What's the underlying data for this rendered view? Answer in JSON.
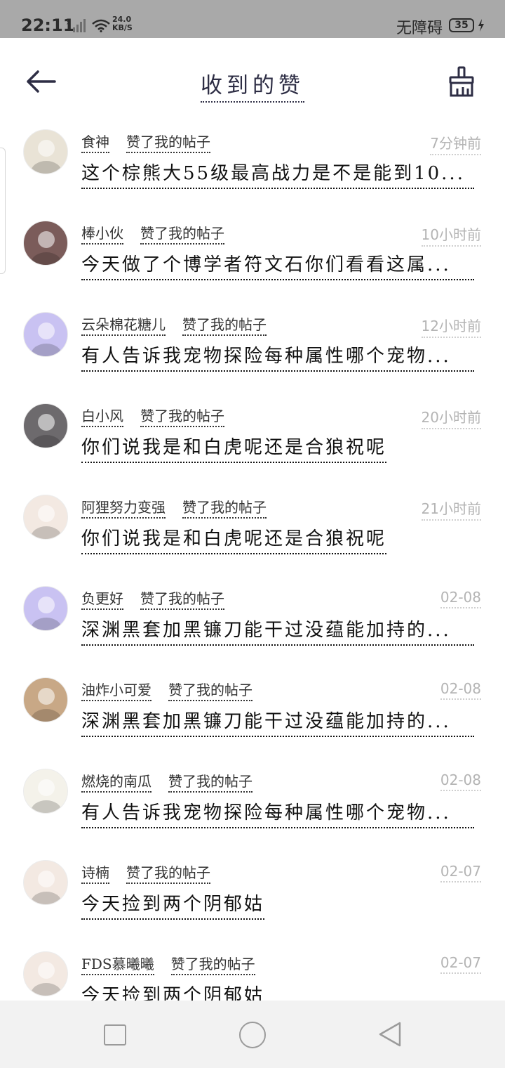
{
  "status_bar": {
    "time": "22:11",
    "speed_value": "24.0",
    "speed_unit": "KB/S",
    "accessibility": "无障碍",
    "battery": "35"
  },
  "header": {
    "title": "收到的赞",
    "back_icon": "arrow-left-icon",
    "clear_icon": "broom-icon"
  },
  "likes": [
    {
      "user": "食神",
      "action": "赞了我的帖子",
      "time": "7分钟前",
      "content": "这个棕熊大55级最高战力是不是能到10...",
      "avatar_color": "#e9e3d6"
    },
    {
      "user": "棒小伙",
      "action": "赞了我的帖子",
      "time": "10小时前",
      "content": "今天做了个博学者符文石你们看看这属...",
      "avatar_color": "#7b5c5a"
    },
    {
      "user": "云朵棉花糖儿",
      "action": "赞了我的帖子",
      "time": "12小时前",
      "content": "有人告诉我宠物探险每种属性哪个宠物...",
      "avatar_color": "#c9c2f2"
    },
    {
      "user": "白小风",
      "action": "赞了我的帖子",
      "time": "20小时前",
      "content": "你们说我是和白虎呢还是合狼祝呢",
      "avatar_color": "#6d6a6d"
    },
    {
      "user": "阿狸努力变强",
      "action": "赞了我的帖子",
      "time": "21小时前",
      "content": "你们说我是和白虎呢还是合狼祝呢",
      "avatar_color": "#f3e9e2"
    },
    {
      "user": "负更好",
      "action": "赞了我的帖子",
      "time": "02-08",
      "content": "深渊黑套加黑镰刀能干过没蕴能加持的...",
      "avatar_color": "#c9c2f2"
    },
    {
      "user": "油炸小可爱",
      "action": "赞了我的帖子",
      "time": "02-08",
      "content": "深渊黑套加黑镰刀能干过没蕴能加持的...",
      "avatar_color": "#c8a886"
    },
    {
      "user": "燃烧的南瓜",
      "action": "赞了我的帖子",
      "time": "02-08",
      "content": "有人告诉我宠物探险每种属性哪个宠物...",
      "avatar_color": "#f4f2ea"
    },
    {
      "user": "诗楠",
      "action": "赞了我的帖子",
      "time": "02-07",
      "content": "今天捡到两个阴郁姑",
      "avatar_color": "#f3e9e2"
    },
    {
      "user": "FDS慕曦曦",
      "action": "赞了我的帖子",
      "time": "02-07",
      "content": "今天捡到两个阴郁姑",
      "avatar_color": "#f3e9e2"
    }
  ],
  "nav": {
    "recent_icon": "square-icon",
    "home_icon": "circle-icon",
    "back_icon": "triangle-back-icon"
  }
}
